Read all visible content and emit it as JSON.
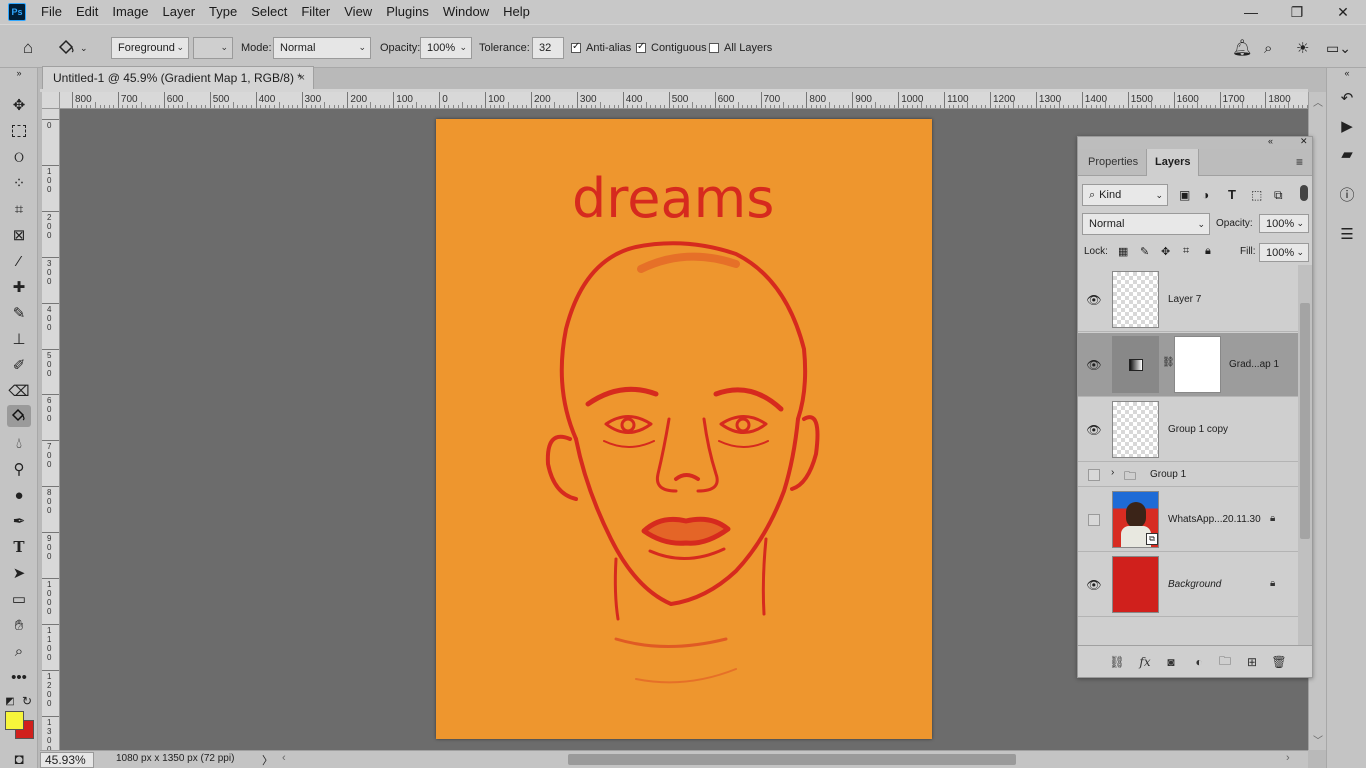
{
  "app": {
    "logo": "Ps"
  },
  "menu": [
    "File",
    "Edit",
    "Image",
    "Layer",
    "Type",
    "Select",
    "Filter",
    "View",
    "Plugins",
    "Window",
    "Help"
  ],
  "window_controls": {
    "minimize": "—",
    "restore": "❐",
    "close": "✕"
  },
  "options_bar": {
    "fill_source": "Foreground",
    "mode_label": "Mode:",
    "mode_value": "Normal",
    "opacity_label": "Opacity:",
    "opacity_value": "100%",
    "tolerance_label": "Tolerance:",
    "tolerance_value": "32",
    "antialias_label": "Anti-alias",
    "antialias_checked": true,
    "contiguous_label": "Contiguous",
    "contiguous_checked": true,
    "all_layers_label": "All Layers",
    "all_layers_checked": false
  },
  "document": {
    "tab_title": "Untitled-1 @ 45.9% (Gradient Map 1, RGB/8) *",
    "close": "×",
    "artwork_text": "dreams",
    "canvas_color": "#ee962e",
    "ink_color": "#d62a1e"
  },
  "rulers": {
    "horizontal": [
      "800",
      "700",
      "600",
      "500",
      "400",
      "300",
      "200",
      "100",
      "0",
      "100",
      "200",
      "300",
      "400",
      "500",
      "600",
      "700",
      "800",
      "900",
      "1000",
      "1100",
      "1200",
      "1300",
      "1400",
      "1500",
      "1600",
      "1700",
      "1800"
    ],
    "vertical": [
      "0",
      "1 0 0",
      "2 0 0",
      "3 0 0",
      "4 0 0",
      "5 0 0",
      "6 0 0",
      "7 0 0",
      "8 0 0",
      "9 0 0",
      "1 0 0 0",
      "1 1 0 0",
      "1 2 0 0",
      "1 3 0 0"
    ]
  },
  "status": {
    "zoom": "45.93%",
    "doc_info": "1080 px x 1350 px (72 ppi)",
    "arrow": "〉"
  },
  "colors": {
    "foreground": "#f7f53b",
    "background": "#d0201c"
  },
  "panel": {
    "tabs": [
      "Properties",
      "Layers"
    ],
    "active_tab": "Layers",
    "filter_kind": "Kind",
    "blend_mode": "Normal",
    "opacity_label": "Opacity:",
    "opacity_value": "100%",
    "lock_label": "Lock:",
    "fill_label": "Fill:",
    "fill_value": "100%",
    "layers": [
      {
        "name": "Layer 7",
        "visible": true
      },
      {
        "name": "Grad...ap 1",
        "visible": true,
        "selected": true
      },
      {
        "name": "Group 1 copy",
        "visible": true
      },
      {
        "name": "Group 1",
        "visible": false
      },
      {
        "name": "WhatsApp...20.11.30",
        "visible": false,
        "locked": true
      },
      {
        "name": "Background",
        "visible": true,
        "locked": true
      }
    ]
  }
}
